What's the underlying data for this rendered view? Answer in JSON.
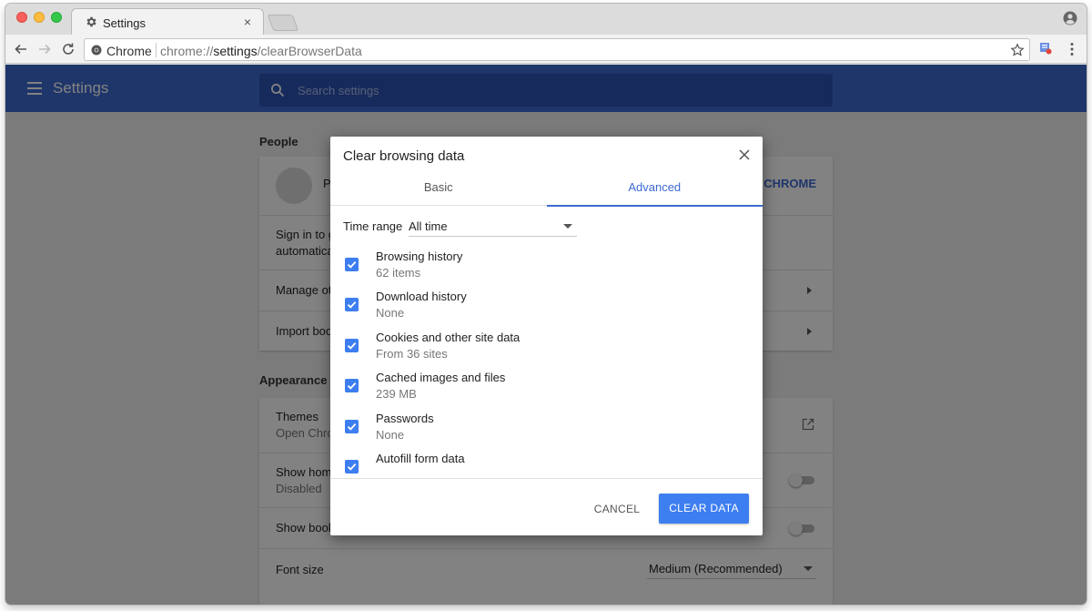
{
  "browser": {
    "tab_title": "Settings",
    "tab_close": "×",
    "omnibox_origin": "Chrome",
    "url_scheme": "chrome://",
    "url_host": "settings",
    "url_path": "/clearBrowserData"
  },
  "settings": {
    "app_title": "Settings",
    "search_placeholder": "Search settings",
    "people": {
      "section_title": "People",
      "account_initial": "P",
      "signin_button": "D CHROME",
      "signin_desc_1": "Sign in to g",
      "signin_desc_2": "automatica",
      "manage_other": "Manage ot",
      "import_bookmarks": "Import boo"
    },
    "appearance": {
      "section_title": "Appearance",
      "themes_label": "Themes",
      "themes_sub": "Open Chron",
      "show_home_label": "Show home",
      "show_home_sub": "Disabled",
      "show_bookmarks_label": "Show book",
      "font_size_label": "Font size",
      "font_size_value": "Medium (Recommended)"
    }
  },
  "dialog": {
    "title": "Clear browsing data",
    "tabs": [
      {
        "label": "Basic",
        "selected": false
      },
      {
        "label": "Advanced",
        "selected": true
      }
    ],
    "time_range_label": "Time range",
    "time_range_value": "All time",
    "items": [
      {
        "title": "Browsing history",
        "subtitle": "62 items",
        "checked": true
      },
      {
        "title": "Download history",
        "subtitle": "None",
        "checked": true
      },
      {
        "title": "Cookies and other site data",
        "subtitle": "From 36 sites",
        "checked": true
      },
      {
        "title": "Cached images and files",
        "subtitle": "239 MB",
        "checked": true
      },
      {
        "title": "Passwords",
        "subtitle": "None",
        "checked": true
      },
      {
        "title": "Autofill form data",
        "subtitle": "",
        "checked": true
      }
    ],
    "cancel_label": "CANCEL",
    "clear_label": "CLEAR DATA"
  },
  "colors": {
    "appbar": "#3d6ad3",
    "accent": "#3d7ef0",
    "link": "#3d6ad3"
  }
}
